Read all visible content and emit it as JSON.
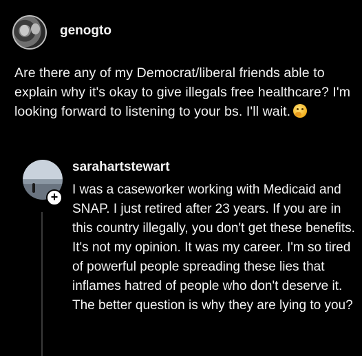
{
  "post": {
    "username": "genogto",
    "text": "Are there any of my Democrat/liberal friends able to explain why it's okay to give illegals free healthcare? I'm looking forward to listening to your bs. I'll wait."
  },
  "reply": {
    "username": "sarahartstewart",
    "text": "I was a caseworker working with Medicaid and SNAP. I just retired after 23 years. If you are in this country illegally, you don't get these benefits. It's not my opinion. It was my career. I'm so tired of powerful people spreading these lies that inflames hatred of people who don't deserve it. The better question is why they are lying to you?"
  },
  "icons": {
    "post_emoji": "thinking-face-emoji",
    "follow_badge": "+"
  }
}
